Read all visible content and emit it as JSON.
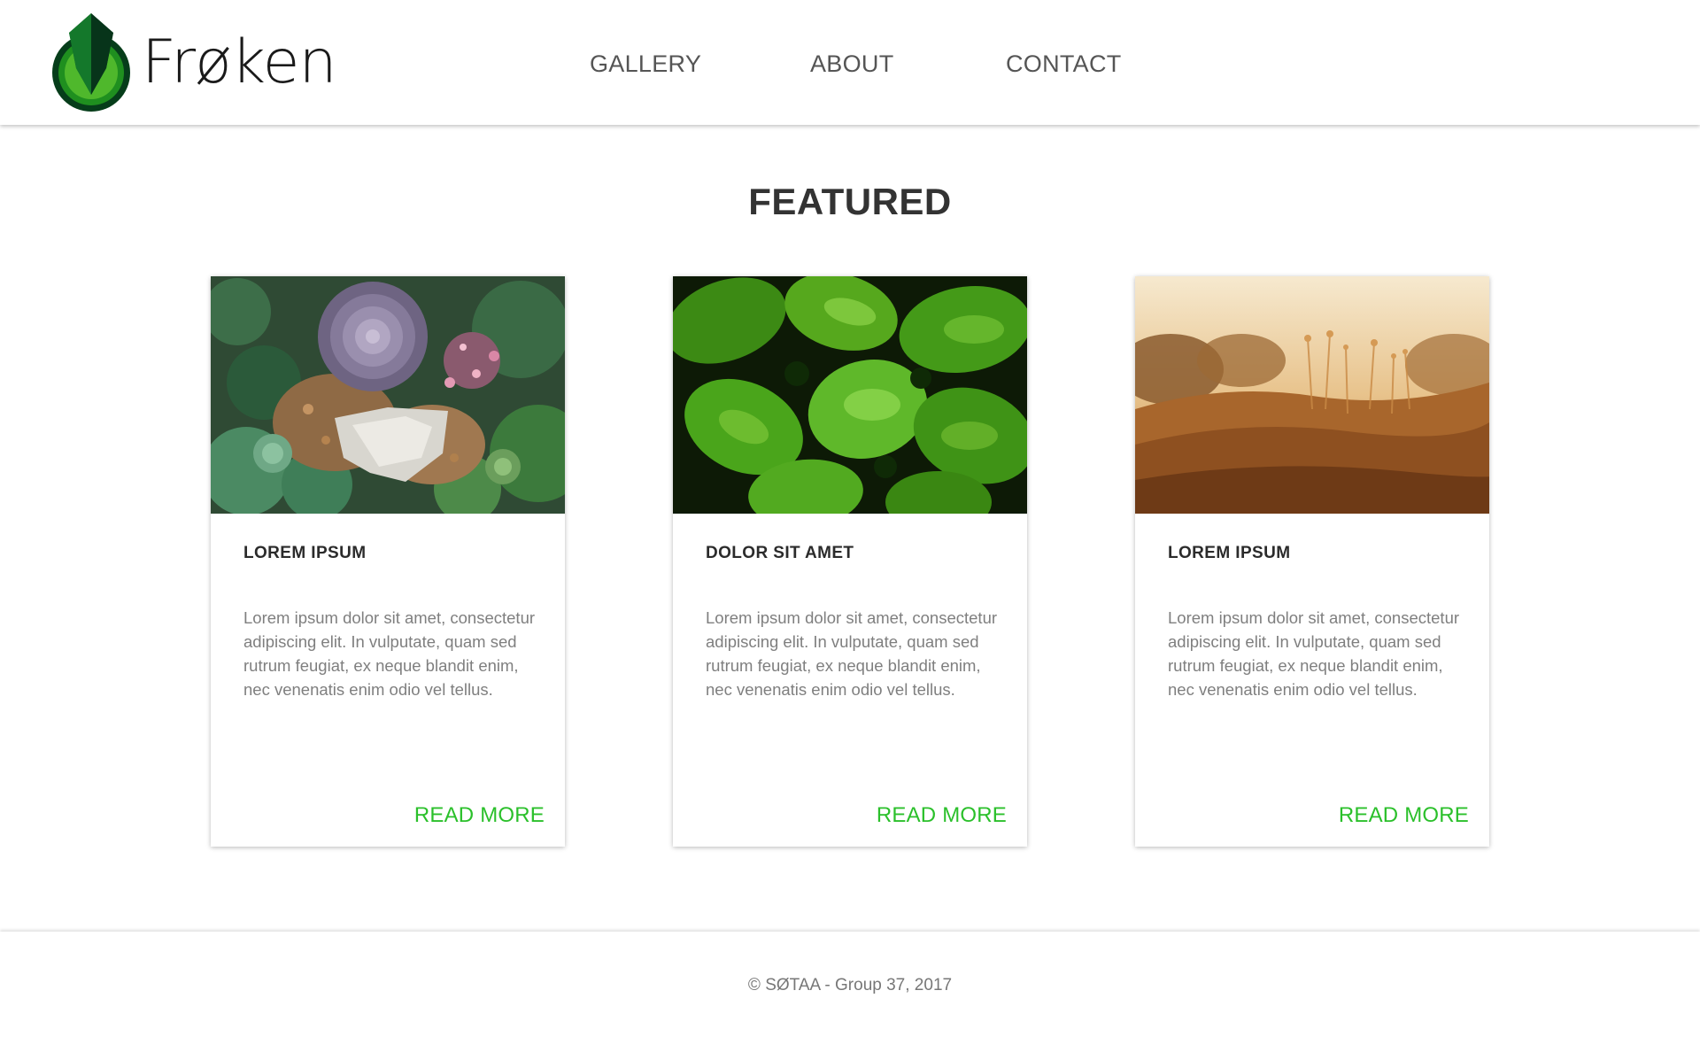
{
  "header": {
    "logo_text": "Frøken",
    "logo_icon": "green-leaf-drop-logo",
    "nav": [
      {
        "label": "GALLERY"
      },
      {
        "label": "ABOUT"
      },
      {
        "label": "CONTACT"
      }
    ]
  },
  "main": {
    "title": "FEATURED",
    "cards": [
      {
        "title": "LOREM IPSUM",
        "image": "succulents-photo",
        "text": "Lorem ipsum dolor sit amet, consectetur adipiscing elit. In vulputate, quam sed rutrum feugiat, ex neque blandit enim, nec venenatis enim odio vel tellus.",
        "link": "READ MORE"
      },
      {
        "title": "DOLOR SIT AMET",
        "image": "green-leaves-photo",
        "text": "Lorem ipsum dolor sit amet, consectetur adipiscing elit. In vulputate, quam sed rutrum feugiat, ex neque blandit enim, nec venenatis enim odio vel tellus.",
        "link": "READ MORE"
      },
      {
        "title": "LOREM IPSUM",
        "image": "golden-field-photo",
        "text": "Lorem ipsum dolor sit amet, consectetur adipiscing elit. In vulputate, quam sed rutrum feugiat, ex neque blandit enim, nec venenatis enim odio vel tellus.",
        "link": "READ MORE"
      }
    ]
  },
  "footer": {
    "text": "© SØTAA - Group 37, 2017"
  },
  "colors": {
    "accent": "#2bc02b",
    "logo_green": "#1c8a1c",
    "text_dark": "#333333",
    "text_muted": "#7f7f7f"
  }
}
